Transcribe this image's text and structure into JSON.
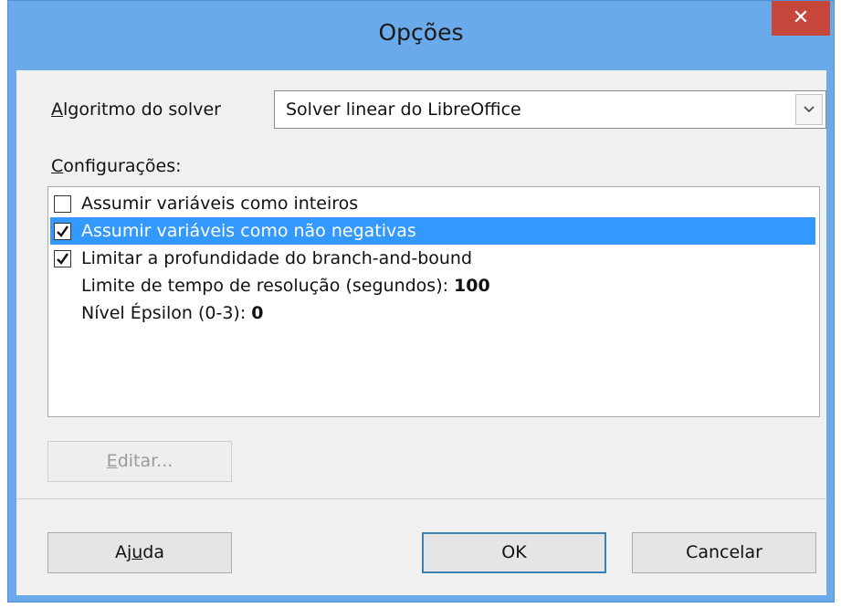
{
  "dialog": {
    "title": "Opções",
    "close_symbol": "✕"
  },
  "solver": {
    "label_accel": "A",
    "label_rest": "lgoritmo do solver",
    "selected": "Solver linear do LibreOffice"
  },
  "settings": {
    "label_accel": "C",
    "label_rest": "onfigurações:",
    "items": [
      {
        "type": "checkbox",
        "checked": false,
        "selected": false,
        "label": "Assumir variáveis como inteiros"
      },
      {
        "type": "checkbox",
        "checked": true,
        "selected": true,
        "label": "Assumir variáveis como não negativas"
      },
      {
        "type": "checkbox",
        "checked": true,
        "selected": false,
        "label": "Limitar a profundidade do branch-and-bound"
      },
      {
        "type": "value",
        "label": "Limite de tempo de resolução (segundos): ",
        "value": "100"
      },
      {
        "type": "value",
        "label": "Nível Épsilon (0-3): ",
        "value": "0"
      }
    ]
  },
  "buttons": {
    "edit_accel": "E",
    "edit_rest": "ditar...",
    "help_pre": "Aj",
    "help_accel": "u",
    "help_post": "da",
    "ok": "OK",
    "cancel": "Cancelar"
  },
  "colors": {
    "title_bar": "#6aa9ea",
    "close_button": "#c7463b",
    "selection": "#3399ff"
  }
}
